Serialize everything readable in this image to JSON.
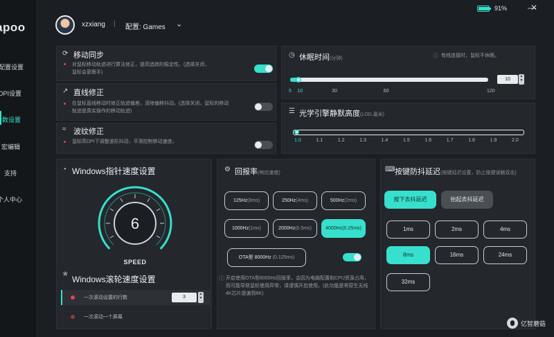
{
  "sidebar": {
    "logo": "apoo",
    "items": [
      {
        "label": "配置设置"
      },
      {
        "label": "DPI设置"
      },
      {
        "label": "参数设置"
      },
      {
        "label": "宏编辑"
      },
      {
        "label": "支持"
      },
      {
        "label": "个人中心"
      }
    ]
  },
  "header": {
    "username": "xzxiang",
    "separator": "|",
    "config": "配置: Games",
    "battery_pct": "91%",
    "battery_level": 0.91,
    "minimize": "—",
    "close": "✕"
  },
  "sync": {
    "title": "移动同步",
    "desc": "对鼠标移动轨迹进行算法修正，提高追踪的稳定性。(选择关闭，鼠标会更跟手)",
    "enabled": true
  },
  "straight": {
    "title": "直线修正",
    "desc": "在鼠标直线移动时修正轨迹偏差，清除偏移抖动。(选择关闭，鼠标的移动轨迹是真实操作的移动轨迹)",
    "enabled": false
  },
  "ripple": {
    "title": "波纹修正",
    "desc": "鼠标高DPI下调整波形抖动，平滑控制移动速度。",
    "enabled": false
  },
  "sleep": {
    "title": "休眠时间",
    "unit": "(分钟)",
    "note": "有线连接时，鼠标不休眠。",
    "value": 10,
    "min": 5,
    "max": 120,
    "ticks": [
      "5",
      "10",
      "30",
      "60",
      "120"
    ]
  },
  "lod": {
    "title": "光学引擎静默高度",
    "unit": "(LOD,毫米)",
    "value": 1.0,
    "ticks": [
      "1.0",
      "1.1",
      "1.2",
      "1.3",
      "1.4",
      "1.5",
      "1.6",
      "1.7",
      "1.8",
      "1.9",
      "2.0"
    ]
  },
  "pointer_speed": {
    "title": "Windows指针速度设置",
    "value": "6",
    "label": "SPEED"
  },
  "scroll_speed": {
    "title": "Windows滚轮速度设置",
    "row1_label": "一次滚动设置的行数",
    "row1_value": "3",
    "row2_label": "一次滚动一个屏幕"
  },
  "polling": {
    "title": "回报率",
    "subtitle": "(响应速度)",
    "options": [
      {
        "hz": "125Hz",
        "ms": "(8ms)"
      },
      {
        "hz": "250Hz",
        "ms": "(4ms)"
      },
      {
        "hz": "500Hz",
        "ms": "(2ms)"
      },
      {
        "hz": "1000Hz",
        "ms": "(1ms)"
      },
      {
        "hz": "2000Hz",
        "ms": "(0.5ms)"
      },
      {
        "hz": "4000Hz",
        "ms": "(0.25ms)"
      }
    ],
    "selected": "4000Hz",
    "ota_hz": "OTA型 8000Hz",
    "ota_ms": "(0.125ms)",
    "ota_enabled": true,
    "note": "开启使用OTA型8000Hz回报率，会因为电脑配置和CPU资源占用，而可能导致鼠标使用异常，请谨慎开启使用。(此功能是将原生无线4K芯片提速到8K)"
  },
  "debounce": {
    "title": "按键防抖延迟",
    "subtitle": "(按键延迟设置，防止按键误触双击)",
    "mode_press": "按下去抖延迟",
    "mode_release": "抬起去抖延迟",
    "selected_mode": "按下去抖延迟",
    "options": [
      "1ms",
      "2ms",
      "4ms",
      "8ms",
      "16ms",
      "24ms",
      "32ms"
    ],
    "selected": "8ms"
  },
  "watermark": "亿智蘑菇"
}
